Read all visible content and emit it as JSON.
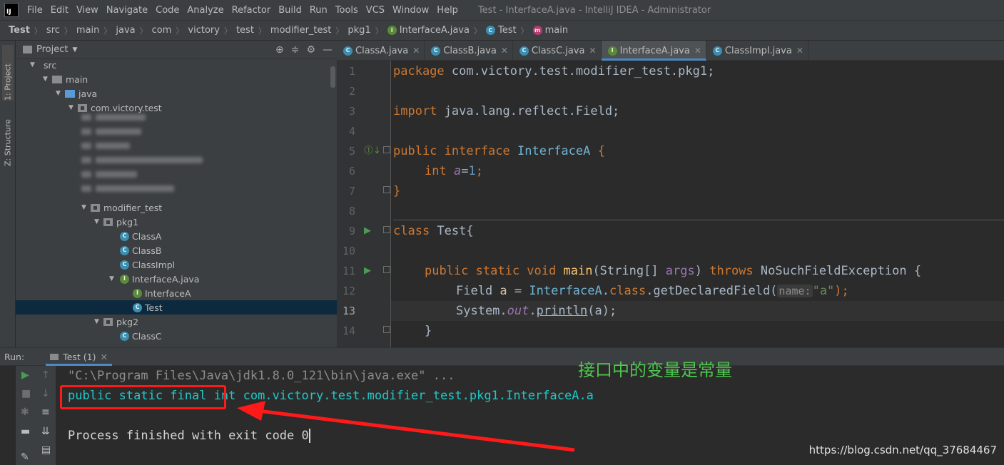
{
  "menu": {
    "logo_text": "IJ",
    "items": [
      "File",
      "Edit",
      "View",
      "Navigate",
      "Code",
      "Analyze",
      "Refactor",
      "Build",
      "Run",
      "Tools",
      "VCS",
      "Window",
      "Help"
    ],
    "window_title": "Test - InterfaceA.java - IntelliJ IDEA - Administrator"
  },
  "breadcrumb": {
    "items": [
      "Test",
      "src",
      "main",
      "java",
      "com",
      "victory",
      "test",
      "modifier_test",
      "pkg1",
      "InterfaceA.java",
      "Test",
      "main"
    ]
  },
  "side_tabs": {
    "project": "1: Project",
    "structure": "Z: Structure"
  },
  "project_panel": {
    "title": "Project",
    "tree": [
      {
        "label": "src",
        "icon": "folder-icon"
      },
      {
        "label": "main",
        "icon": "folder-icon"
      },
      {
        "label": "java",
        "icon": "source-folder-icon"
      },
      {
        "label": "com.victory.test",
        "icon": "package-icon"
      },
      {
        "label": "modifier_test",
        "icon": "package-icon"
      },
      {
        "label": "pkg1",
        "icon": "package-icon"
      },
      {
        "label": "ClassA",
        "icon": "class-icon"
      },
      {
        "label": "ClassB",
        "icon": "class-icon"
      },
      {
        "label": "ClassImpl",
        "icon": "class-icon"
      },
      {
        "label": "InterfaceA.java",
        "icon": "interface-icon"
      },
      {
        "label": "InterfaceA",
        "icon": "interface-icon"
      },
      {
        "label": "Test",
        "icon": "class-icon"
      },
      {
        "label": "pkg2",
        "icon": "package-icon"
      },
      {
        "label": "ClassC",
        "icon": "class-icon"
      }
    ]
  },
  "editor_tabs": [
    {
      "label": "ClassA.java",
      "icon": "class-icon"
    },
    {
      "label": "ClassB.java",
      "icon": "class-icon"
    },
    {
      "label": "ClassC.java",
      "icon": "class-icon"
    },
    {
      "label": "InterfaceA.java",
      "icon": "interface-icon",
      "active": true
    },
    {
      "label": "ClassImpl.java",
      "icon": "class-icon"
    }
  ],
  "editor": {
    "line_numbers": [
      "1",
      "2",
      "3",
      "4",
      "5",
      "6",
      "7",
      "8",
      "9",
      "10",
      "11",
      "12",
      "13",
      "14"
    ],
    "current_line": "13",
    "code": {
      "l1_kw": "package",
      "l1_rest": " com.victory.test.modifier_test.pkg1;",
      "l3_kw": "import",
      "l3_rest": " java.lang.reflect.Field;",
      "l5_kw": "public interface",
      "l5_name": "InterfaceA",
      "l5_brace": " {",
      "l6_kw": "int",
      "l6_var": "a",
      "l6_eq": "=",
      "l6_num": "1",
      "l6_semi": ";",
      "l7": "}",
      "l9_kw": "class",
      "l9_rest": " Test{",
      "l11_kw": "public static void",
      "l11_fn": "main",
      "l11_type": "(String[] ",
      "l11_param": "args",
      "l11_close": ") ",
      "l11_throws": "throws",
      "l11_exc": " NoSuchFieldException {",
      "l12_type": "Field ",
      "l12_var": "a",
      "l12_eq": " = ",
      "l12_cls": "InterfaceA",
      "l12_dot": ".",
      "l12_kw": "class",
      "l12_call": ".getDeclaredField(",
      "l12_hint": "name:",
      "l12_str": "\"a\"",
      "l12_end": ");",
      "l13_obj": "System.",
      "l13_out": "out",
      "l13_dot": ".",
      "l13_fn": "println",
      "l13_args": "(a);",
      "l14": "}"
    }
  },
  "run_panel": {
    "label": "Run:",
    "tab": "Test (1)",
    "output": {
      "cmd": "\"C:\\Program Files\\Java\\jdk1.8.0_121\\bin\\java.exe\" ...",
      "result": "public static final int com.victory.test.modifier_test.pkg1.InterfaceA.a",
      "finish": "Process finished with exit code 0"
    }
  },
  "annotation": "接口中的变量是常量",
  "watermark": "https://blog.csdn.net/qq_37684467",
  "colors": {
    "annotation": "#4ec54e",
    "highlight_box": "#ff1a1a",
    "arrow": "#ff1a1a"
  }
}
